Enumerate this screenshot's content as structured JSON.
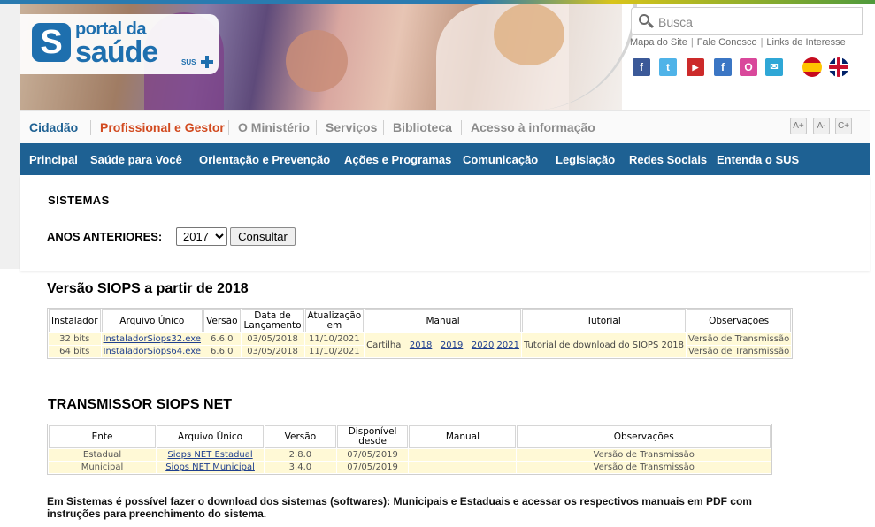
{
  "logo": {
    "letter": "S",
    "line1": "portal da",
    "line2": "saúde",
    "tag": "SUS"
  },
  "search": {
    "placeholder": "Busca"
  },
  "util_links": [
    "Mapa do Site",
    "Fale Conosco",
    "Links de Interesse"
  ],
  "social": [
    {
      "name": "facebook-icon",
      "glyph": "f",
      "color": "#3b5998"
    },
    {
      "name": "twitter-icon",
      "glyph": "t",
      "color": "#4fb3e8"
    },
    {
      "name": "youtube-icon",
      "glyph": "▶",
      "color": "#cc2a2a"
    },
    {
      "name": "flickr-icon",
      "glyph": "f",
      "color": "#3b76c4"
    },
    {
      "name": "orkut-icon",
      "glyph": "O",
      "color": "#d9489b"
    },
    {
      "name": "chat-icon",
      "glyph": "✉",
      "color": "#2fa7d6"
    }
  ],
  "flags": [
    {
      "name": "spanish-flag-icon",
      "color": "#e8b400"
    },
    {
      "name": "english-flag-icon",
      "color": "#c8102e"
    }
  ],
  "nav1": {
    "items": [
      "Cidadão",
      "Profissional e Gestor",
      "O Ministério",
      "Serviços",
      "Biblioteca",
      "Acesso à informação"
    ],
    "font_buttons": [
      "A+",
      "A-",
      "C+"
    ],
    "colors": {
      "first": "#1e6193",
      "active": "#d24a1f",
      "default": "#8c8c8c"
    }
  },
  "nav2": {
    "items": [
      "Principal",
      "Saúde para Você",
      "Orientação e Prevenção",
      "Ações e Programas",
      "Comunicação",
      "Legislação",
      "Redes Sociais",
      "Entenda o SUS"
    ]
  },
  "page": {
    "title": "SISTEMAS",
    "anos_label": "ANOS ANTERIORES:",
    "year_selected": "2017",
    "consultar_label": "Consultar"
  },
  "siops": {
    "title": "Versão SIOPS a partir de 2018",
    "headers": [
      "Instalador",
      "Arquivo Único",
      "Versão",
      "Data de Lançamento",
      "Atualização em",
      "Manual",
      "Tutorial",
      "Observações"
    ],
    "rows": [
      {
        "instalador": "32 bits",
        "arquivo": "InstaladorSiops32.exe",
        "versao": "6.6.0",
        "data": "03/05/2018",
        "atualizacao": "11/10/2021",
        "observacoes": "Versão de Transmissão"
      },
      {
        "instalador": "64 bits",
        "arquivo": "InstaladorSiops64.exe",
        "versao": "6.6.0",
        "data": "03/05/2018",
        "atualizacao": "11/10/2021",
        "observacoes": "Versão de Transmissão"
      }
    ],
    "manual": {
      "label": "Cartilha",
      "years": [
        "2018",
        "2019",
        "2020",
        "2021"
      ]
    },
    "tutorial": "Tutorial de download do SIOPS 2018"
  },
  "net": {
    "title": "TRANSMISSOR SIOPS NET",
    "headers": [
      "Ente",
      "Arquivo Único",
      "Versão",
      "Disponível desde",
      "Manual",
      "Observações"
    ],
    "rows": [
      {
        "ente": "Estadual",
        "arquivo": "Siops NET Estadual",
        "versao": "2.8.0",
        "desde": "07/05/2019",
        "manual": "",
        "observacoes": "Versão de Transmissão"
      },
      {
        "ente": "Municipal",
        "arquivo": "Siops NET Municipal",
        "versao": "3.4.0",
        "desde": "07/05/2019",
        "manual": "",
        "observacoes": "Versão de Transmissão"
      }
    ]
  },
  "footer_text": "Em Sistemas é possível fazer o download dos sistemas (softwares): Municipais e Estaduais e acessar os respectivos manuais em PDF com instruções para preenchimento do sistema."
}
